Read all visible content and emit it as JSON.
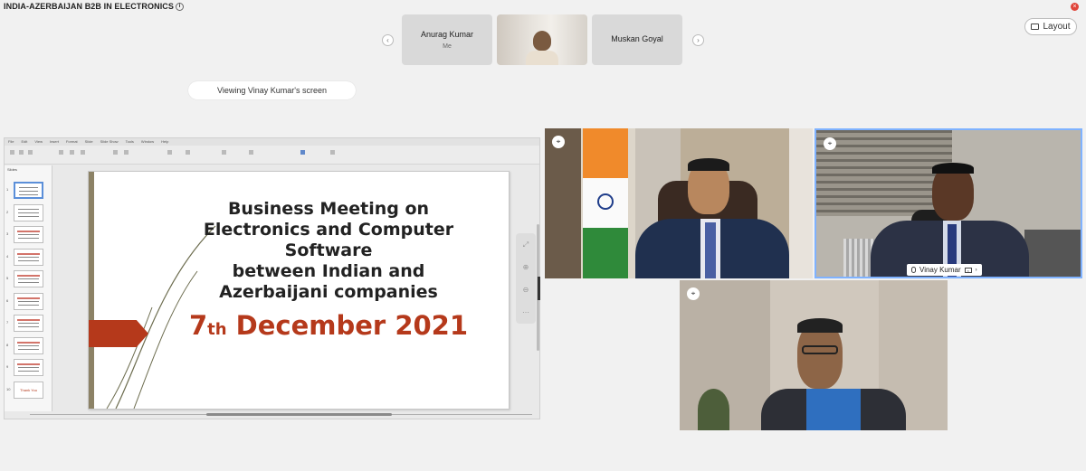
{
  "meeting": {
    "title": "INDIA-AZERBAIJAN B2B IN ELECTRONICS",
    "info_icon": "info-icon",
    "layout_label": "Layout"
  },
  "participant_strip": {
    "tiles": [
      {
        "name": "Anurag Kumar",
        "sub": "Me"
      },
      {
        "name": "",
        "sub": ""
      },
      {
        "name": "Muskan Goyal",
        "sub": ""
      }
    ],
    "prev_icon": "chevron-left-icon",
    "next_icon": "chevron-right-icon"
  },
  "screen_share": {
    "viewing_label": "Viewing Vinay Kumar's screen",
    "menu_items": [
      "File",
      "Edit",
      "View",
      "Insert",
      "Format",
      "Slide",
      "Slide Show",
      "Tools",
      "Window",
      "Help"
    ],
    "slides_label": "Slides",
    "slide": {
      "title_lines": [
        "Business Meeting on",
        "Electronics and Computer",
        "Software",
        "between Indian and",
        "Azerbaijani companies"
      ],
      "date_day": "7",
      "date_suffix": "th",
      "date_rest": "December  2021",
      "accent_color": "#b5391b"
    },
    "thumb_count": 10,
    "last_thumb_text": "Thank You"
  },
  "videos": [
    {
      "name": ""
    },
    {
      "name": "Vinay Kumar"
    },
    {
      "name": ""
    }
  ]
}
